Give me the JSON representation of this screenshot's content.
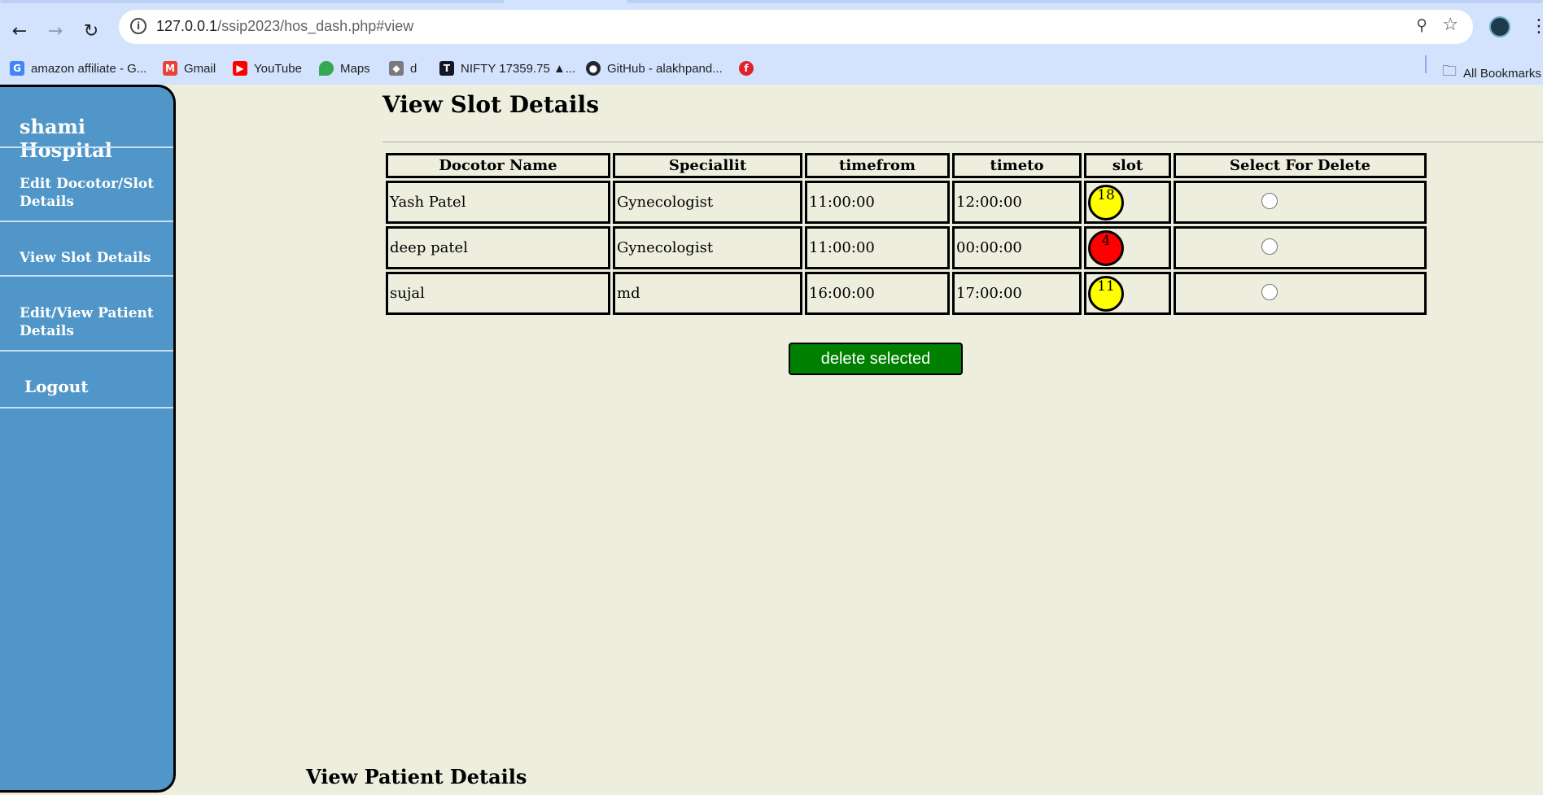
{
  "browser": {
    "url_host": "127.0.0.1",
    "url_path": "/ssip2023/hos_dash.php#view",
    "bookmarks": [
      {
        "label": "amazon affiliate - G...",
        "icon": "google-icon",
        "color": "#4285f4"
      },
      {
        "label": "Gmail",
        "icon": "gmail-icon",
        "color": "#ea4335"
      },
      {
        "label": "YouTube",
        "icon": "youtube-icon",
        "color": "#ff0000"
      },
      {
        "label": "Maps",
        "icon": "maps-icon",
        "color": "#34a853"
      },
      {
        "label": "d",
        "icon": "bookmark-d-icon",
        "color": "#7a7a7a"
      },
      {
        "label": "NIFTY 17359.75 ▲...",
        "icon": "tradingview-icon",
        "color": "#131722"
      },
      {
        "label": "GitHub - alakhpand...",
        "icon": "github-icon",
        "color": "#24292f"
      },
      {
        "label": "",
        "icon": "flipkart-icon",
        "color": "#e0232a"
      }
    ],
    "all_bookmarks": "All Bookmarks"
  },
  "sidebar": {
    "title": "shami Hospital",
    "items": [
      {
        "label": "Edit Docotor/Slot Details"
      },
      {
        "label": "View Slot Details"
      },
      {
        "label": "Edit/View Patient Details"
      }
    ],
    "logout": "Logout"
  },
  "main": {
    "title": "View Slot Details",
    "columns": [
      "Docotor Name",
      "Speciallit",
      "timefrom",
      "timeto",
      "slot",
      "Select For Delete"
    ],
    "rows": [
      {
        "name": "Yash Patel",
        "speciality": "Gynecologist",
        "timefrom": "11:00:00",
        "timeto": "12:00:00",
        "slot": "18",
        "slot_color": "#ffff00"
      },
      {
        "name": "deep patel",
        "speciality": "Gynecologist",
        "timefrom": "11:00:00",
        "timeto": "00:00:00",
        "slot": "4",
        "slot_color": "#ff0000"
      },
      {
        "name": "sujal",
        "speciality": "md",
        "timefrom": "16:00:00",
        "timeto": "17:00:00",
        "slot": "11",
        "slot_color": "#ffff00"
      }
    ],
    "delete_button": "delete selected",
    "patient_title": "View Patient Details"
  }
}
